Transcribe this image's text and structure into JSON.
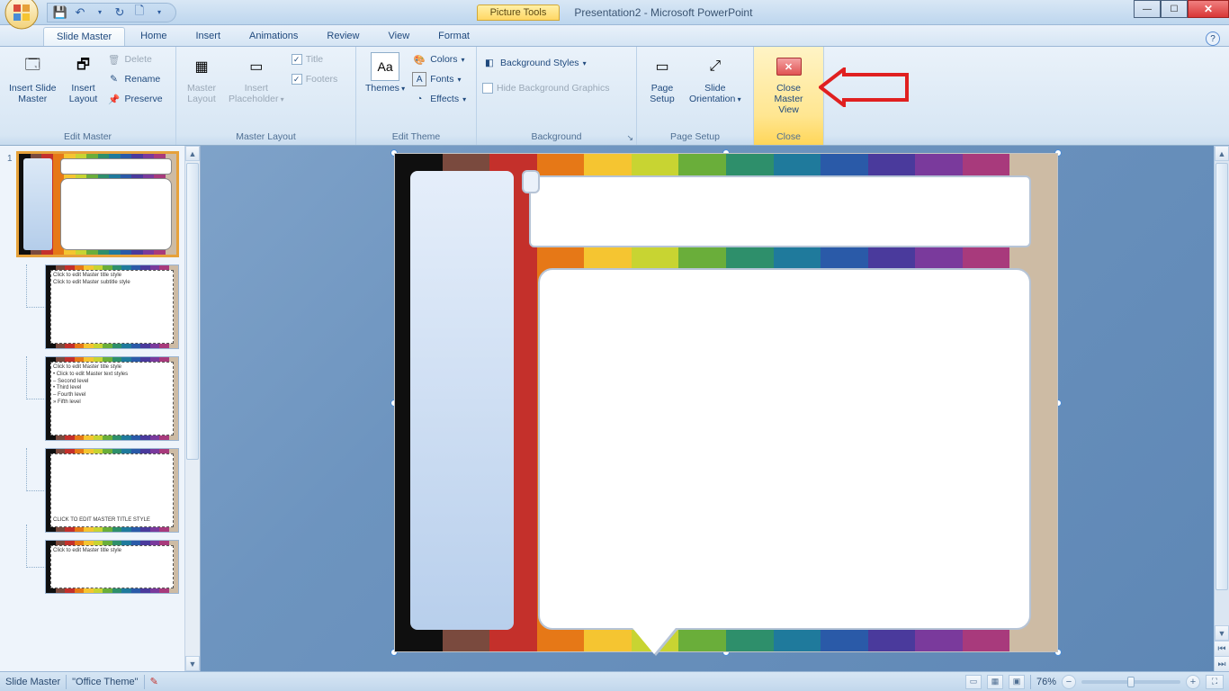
{
  "titlebar": {
    "context_tab": "Picture Tools",
    "app_title": "Presentation2 - Microsoft PowerPoint"
  },
  "tabs": {
    "slide_master": "Slide Master",
    "home": "Home",
    "insert": "Insert",
    "animations": "Animations",
    "review": "Review",
    "view": "View",
    "format": "Format"
  },
  "ribbon": {
    "edit_master": {
      "label": "Edit Master",
      "insert_slide_master": "Insert Slide\nMaster",
      "insert_layout": "Insert\nLayout",
      "delete": "Delete",
      "rename": "Rename",
      "preserve": "Preserve"
    },
    "master_layout": {
      "label": "Master Layout",
      "master_layout_btn": "Master\nLayout",
      "insert_placeholder": "Insert\nPlaceholder",
      "title": "Title",
      "footers": "Footers"
    },
    "edit_theme": {
      "label": "Edit Theme",
      "themes": "Themes",
      "colors": "Colors",
      "fonts": "Fonts",
      "effects": "Effects"
    },
    "background": {
      "label": "Background",
      "styles": "Background Styles",
      "hide": "Hide Background Graphics"
    },
    "page_setup": {
      "label": "Page Setup",
      "page_setup_btn": "Page\nSetup",
      "orientation": "Slide\nOrientation"
    },
    "close": {
      "label": "Close",
      "close_btn": "Close\nMaster View"
    }
  },
  "thumbnails": {
    "master_num": "1",
    "l1_title": "Click to edit Master title style",
    "l1_sub": "Click to edit Master subtitle style",
    "l2_title": "Click to edit Master title style",
    "l2_body": "• Click to edit Master text styles\n  – Second level\n    • Third level\n      – Fourth level\n        » Fifth level",
    "l3_title": "CLICK TO EDIT MASTER TITLE STYLE",
    "l4_title": "Click to edit Master title style"
  },
  "statusbar": {
    "mode": "Slide Master",
    "theme": "\"Office Theme\"",
    "zoom": "76%"
  }
}
